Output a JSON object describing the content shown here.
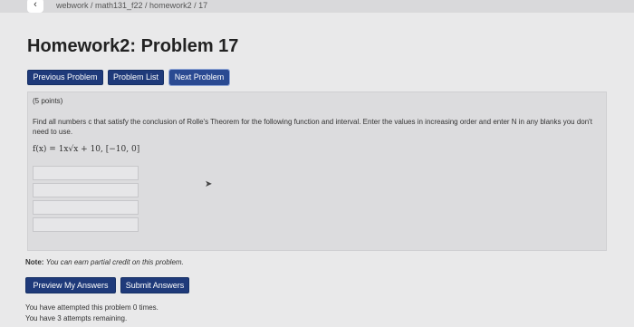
{
  "header": {
    "back_label": "‹",
    "breadcrumb": "webwork / math131_f22 / homework2 / 17"
  },
  "page_title": "Homework2: Problem 17",
  "nav": {
    "previous": "Previous Problem",
    "list": "Problem List",
    "next": "Next Problem"
  },
  "problem": {
    "points": "(5 points)",
    "instructions": "Find all numbers c that satisfy the conclusion of Rolle's Theorem for the following function and interval. Enter the values in increasing order and enter N in any blanks you don't need to use.",
    "formula": "f(x) = 1x√x + 10, [−10, 0]",
    "answer_values": [
      "",
      "",
      "",
      ""
    ]
  },
  "note": {
    "label": "Note:",
    "text": "You can earn partial credit on this problem."
  },
  "actions": {
    "preview": "Preview My Answers",
    "submit": "Submit Answers"
  },
  "status": {
    "attempts": "You have attempted this problem 0 times.",
    "remaining": "You have 3 attempts remaining."
  }
}
